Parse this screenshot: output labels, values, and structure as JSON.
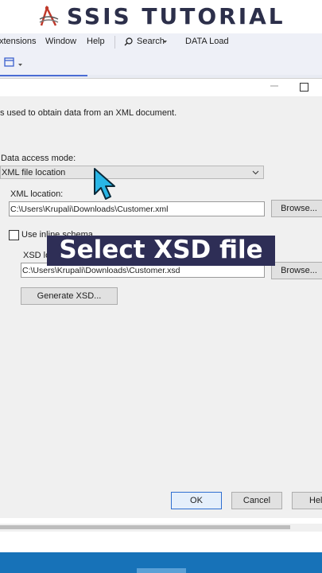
{
  "banner": {
    "title": "SSIS TUTORIAL",
    "logo_icon": "ssis-logo-icon"
  },
  "menubar": {
    "items": [
      "xtensions",
      "Window",
      "Help"
    ],
    "search_label": "Search",
    "search_icon": "search-icon",
    "project_label": "DATA Load"
  },
  "dialog": {
    "description": "s used to obtain data from an XML document.",
    "access_mode_label": "Data access mode:",
    "access_mode_value": "XML file location",
    "xml_location_label": "XML location:",
    "xml_location_value": "C:\\Users\\Krupali\\Downloads\\Customer.xml",
    "browse_label": "Browse...",
    "inline_schema_label": "Use inline schema",
    "inline_schema_checked": false,
    "xsd_location_label": "XSD location:",
    "xsd_location_value": "C:\\Users\\Krupali\\Downloads\\Customer.xsd",
    "generate_xsd_label": "Generate XSD...",
    "ok_label": "OK",
    "cancel_label": "Cancel",
    "help_label": "Help"
  },
  "overlay": {
    "caption": "Select XSD file"
  },
  "colors": {
    "accent": "#2f6fd1",
    "banner_text": "#2c2f4a",
    "overlay_bg": "#2e2e56",
    "taskbar": "#1772b8",
    "cursor": "#29b6e6"
  }
}
